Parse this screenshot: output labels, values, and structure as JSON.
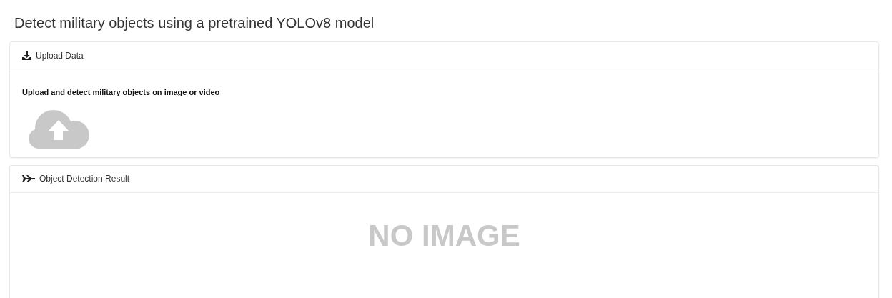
{
  "page_title": "Detect military objects using a pretrained YOLOv8 model",
  "upload_card": {
    "title": "Upload Data",
    "prompt": "Upload and detect military objects on image or video"
  },
  "result_card": {
    "title": "Object Detection Result",
    "placeholder_text": "NO IMAGE"
  }
}
